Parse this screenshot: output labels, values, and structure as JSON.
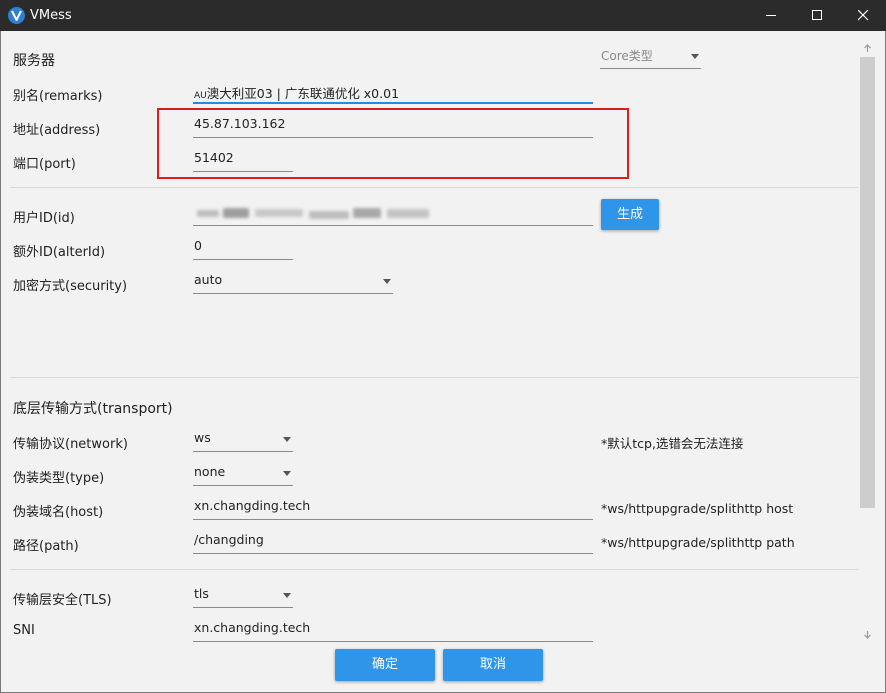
{
  "window": {
    "title": "VMess"
  },
  "server": {
    "section_title": "服务器",
    "core_type_placeholder": "Core类型",
    "remarks_label": "别名(remarks)",
    "remarks_prefix": "AU",
    "remarks_value": "澳大利亚03 | 广东联通优化 x0.01",
    "address_label": "地址(address)",
    "address_value": "45.87.103.162",
    "port_label": "端口(port)",
    "port_value": "51402",
    "id_label": "用户ID(id)",
    "generate_label": "生成",
    "alterid_label": "额外ID(alterId)",
    "alterid_value": "0",
    "security_label": "加密方式(security)",
    "security_value": "auto"
  },
  "transport": {
    "section_title": "底层传输方式(transport)",
    "network_label": "传输协议(network)",
    "network_value": "ws",
    "network_hint": "*默认tcp,选错会无法连接",
    "type_label": "伪装类型(type)",
    "type_value": "none",
    "host_label": "伪装域名(host)",
    "host_value": "xn.changding.tech",
    "host_hint": "*ws/httpupgrade/splithttp host",
    "path_label": "路径(path)",
    "path_value": "/changding",
    "path_hint": "*ws/httpupgrade/splithttp path"
  },
  "tls": {
    "tls_label": "传输层安全(TLS)",
    "tls_value": "tls",
    "sni_label": "SNI",
    "sni_value": "xn.changding.tech"
  },
  "footer": {
    "ok_label": "确定",
    "cancel_label": "取消"
  },
  "colors": {
    "titlebar": "#2b2b2b",
    "accent": "#2f95e8",
    "highlight": "#e01b1b"
  }
}
